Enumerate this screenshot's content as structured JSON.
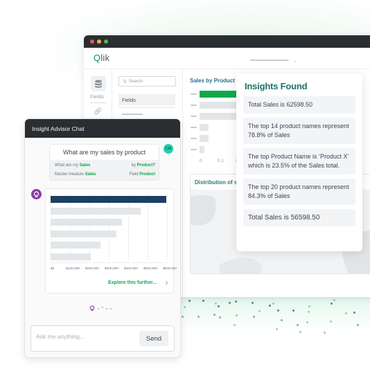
{
  "window": {
    "app_name_prefix": "Q",
    "app_name_rest": "lik",
    "rail": {
      "fields_label": "Fields"
    },
    "fields_panel": {
      "search_placeholder": "Search",
      "fields_button": "Fields"
    },
    "chart": {
      "title": "Sales by Product I",
      "x_labels": [
        "0",
        "0.1",
        "0"
      ],
      "bars": [
        {
          "value": 0.23,
          "highlight": true
        },
        {
          "value": 0.2,
          "highlight": false
        },
        {
          "value": 0.18,
          "highlight": false
        },
        {
          "value": 0.04,
          "highlight": false
        },
        {
          "value": 0.04,
          "highlight": false
        },
        {
          "value": 0.02,
          "highlight": false
        }
      ],
      "max": 0.2,
      "highlight_color": "#0fa94c",
      "bar_color": "#e3e6e8"
    },
    "distribution": {
      "title": "Distribution of s"
    }
  },
  "insights": {
    "title": "Insights Found",
    "items": [
      "Total Sales is 62598.50",
      "The top 14 product names represent 78.8% of Sales",
      "The top Product Name is ‘Product X’ which is 23.5% of the Sales total.",
      "The top 20 product names represent 84.3% of Sales",
      "Total Sales is 56598.50"
    ]
  },
  "chat": {
    "title": "Insight Advisor Chat",
    "query": "What are my sales by product",
    "user_initials": "CM",
    "parse": {
      "row1_left_prefix": "What are my ",
      "row1_left_term": "Sales",
      "row1_right_prefix": "by ",
      "row1_right_term": "Product?",
      "row2_left_prefix": "Master meature ",
      "row2_left_term": "Sales",
      "row2_right_prefix": "Field ",
      "row2_right_term": "Product"
    },
    "result_chart": {
      "x_labels": [
        "$0",
        "$100,000",
        "$200,000",
        "$300,000",
        "$400,000",
        "$500,000",
        "$600,000"
      ],
      "values": [
        615000,
        480000,
        380000,
        350000,
        265000,
        215000
      ],
      "max": 620000,
      "highlight_color": "#1c3f63",
      "bar_color": "#e3e6e8"
    },
    "explore_label": "Explore this further...",
    "input_placeholder": "Ask me anything...",
    "send_label": "Send"
  }
}
